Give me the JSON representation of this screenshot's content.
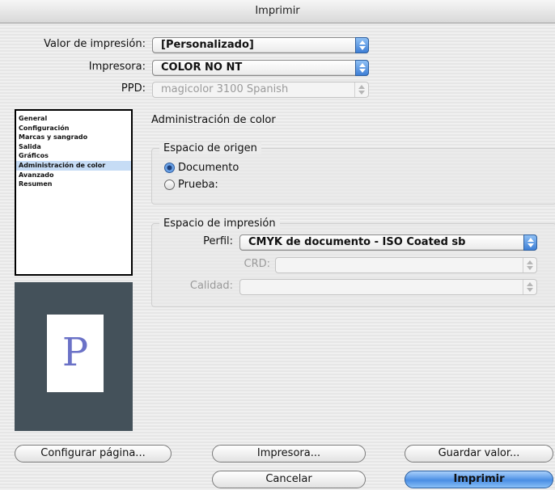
{
  "window": {
    "title": "Imprimir"
  },
  "top": {
    "preset": {
      "label": "Valor de impresión:",
      "value": "[Personalizado]"
    },
    "printer": {
      "label": "Impresora:",
      "value": "COLOR NO NT"
    },
    "ppd": {
      "label": "PPD:",
      "value": "magicolor 3100 Spanish"
    }
  },
  "sidebar": {
    "items": [
      {
        "label": "General"
      },
      {
        "label": "Configuración"
      },
      {
        "label": "Marcas y sangrado"
      },
      {
        "label": "Salida"
      },
      {
        "label": "Gráficos"
      },
      {
        "label": "Administración de color"
      },
      {
        "label": "Avanzado"
      },
      {
        "label": "Resumen"
      }
    ],
    "selected_index": 5
  },
  "preview": {
    "page_letter": "P"
  },
  "panel": {
    "title": "Administración de color",
    "source_space": {
      "title": "Espacio de origen",
      "options": [
        "Documento",
        "Prueba:"
      ],
      "selected": "Documento"
    },
    "print_space": {
      "title": "Espacio de impresión",
      "profile_label": "Perfil:",
      "profile_value": "CMYK de documento - ISO Coated sb",
      "crd_label": "CRD:",
      "crd_value": "",
      "quality_label": "Calidad:",
      "quality_value": ""
    }
  },
  "buttons": {
    "setup_page": "Configurar página...",
    "printer": "Impresora...",
    "save_preset": "Guardar valor...",
    "cancel": "Cancelar",
    "print": "Imprimir"
  }
}
